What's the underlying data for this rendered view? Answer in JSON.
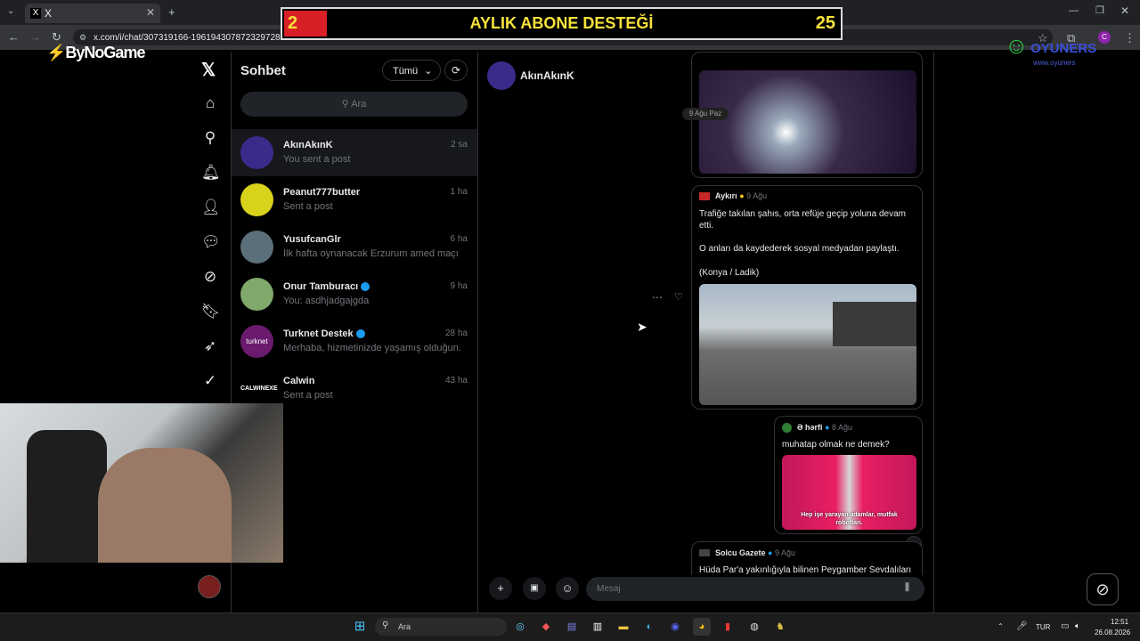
{
  "browser": {
    "tab_title": "X",
    "tab_icon": "X",
    "url": "x.com/i/chat/307319166-1961943078723297280"
  },
  "overlay": {
    "banner_left": "2",
    "banner_text": "AYLIK ABONE DESTEĞİ",
    "banner_right": "25",
    "brand_left": "ByNoGame",
    "brand_right": "OYUNERS",
    "brand_right_sub": "www.oyuners"
  },
  "sidebar": {
    "items": [
      "home-icon",
      "search-icon",
      "notifications-icon",
      "follow-icon",
      "messages-icon",
      "grok-icon",
      "bookmarks-icon",
      "premium-icon",
      "verified-icon"
    ]
  },
  "conversations": {
    "title": "Sohbet",
    "filter": "Tümü",
    "search_placeholder": "Ara",
    "items": [
      {
        "name": "AkınAkınK",
        "preview": "You sent a post",
        "time": "2 sa",
        "verified": false
      },
      {
        "name": "Peanut777butter",
        "preview": "Sent a post",
        "time": "1 ha",
        "verified": false
      },
      {
        "name": "YusufcanGlr",
        "preview": "İlk hafta oynanacak Erzurum amed maçı",
        "time": "6 ha",
        "verified": false
      },
      {
        "name": "Onur Tamburacı",
        "preview": "You: asdhjadgajgda",
        "time": "9 ha",
        "verified": true
      },
      {
        "name": "Turknet Destek",
        "preview": "Merhaba, hizmetinizde yaşamış olduğun...",
        "time": "28 ha",
        "verified": true
      },
      {
        "name": "Calwin",
        "preview": "Sent a post",
        "time": "43 ha",
        "verified": false
      }
    ],
    "calwin_logo": "CALWINEXE",
    "turknet_logo": "turknet"
  },
  "chat": {
    "contact": "AkınAkınK",
    "date_pill": "9 Ağu Paz",
    "posts": [
      {
        "source": "Aykırı",
        "date": "9 Ağu",
        "text": [
          "Trafiğe takılan şahıs, orta refüje geçip yoluna devam etti.",
          "O anları da kaydederek sosyal medyadan paylaştı.",
          "(Konya / Ladik)"
        ]
      },
      {
        "source": "Ə hərfi",
        "date": "8 Ağu",
        "text": [
          "muhatap olmak ne demek?"
        ],
        "caption": "Hep işe yarayan adamlar, mutfak robotları."
      },
      {
        "source": "Solcu Gazete",
        "date": "9 Ağu",
        "text": [
          "Hüda Par'a yakınlığıyla bilinen Peygamber Sevdalıları"
        ]
      }
    ],
    "message_placeholder": "Mesaj"
  },
  "taskbar": {
    "search": "Ara",
    "lang": "TUR",
    "time": "12:51",
    "date": "26.08.2026"
  },
  "colors": {
    "accent": "#1d9bf0",
    "banner_red": "#d81f26",
    "banner_yellow": "#f7e23a"
  }
}
